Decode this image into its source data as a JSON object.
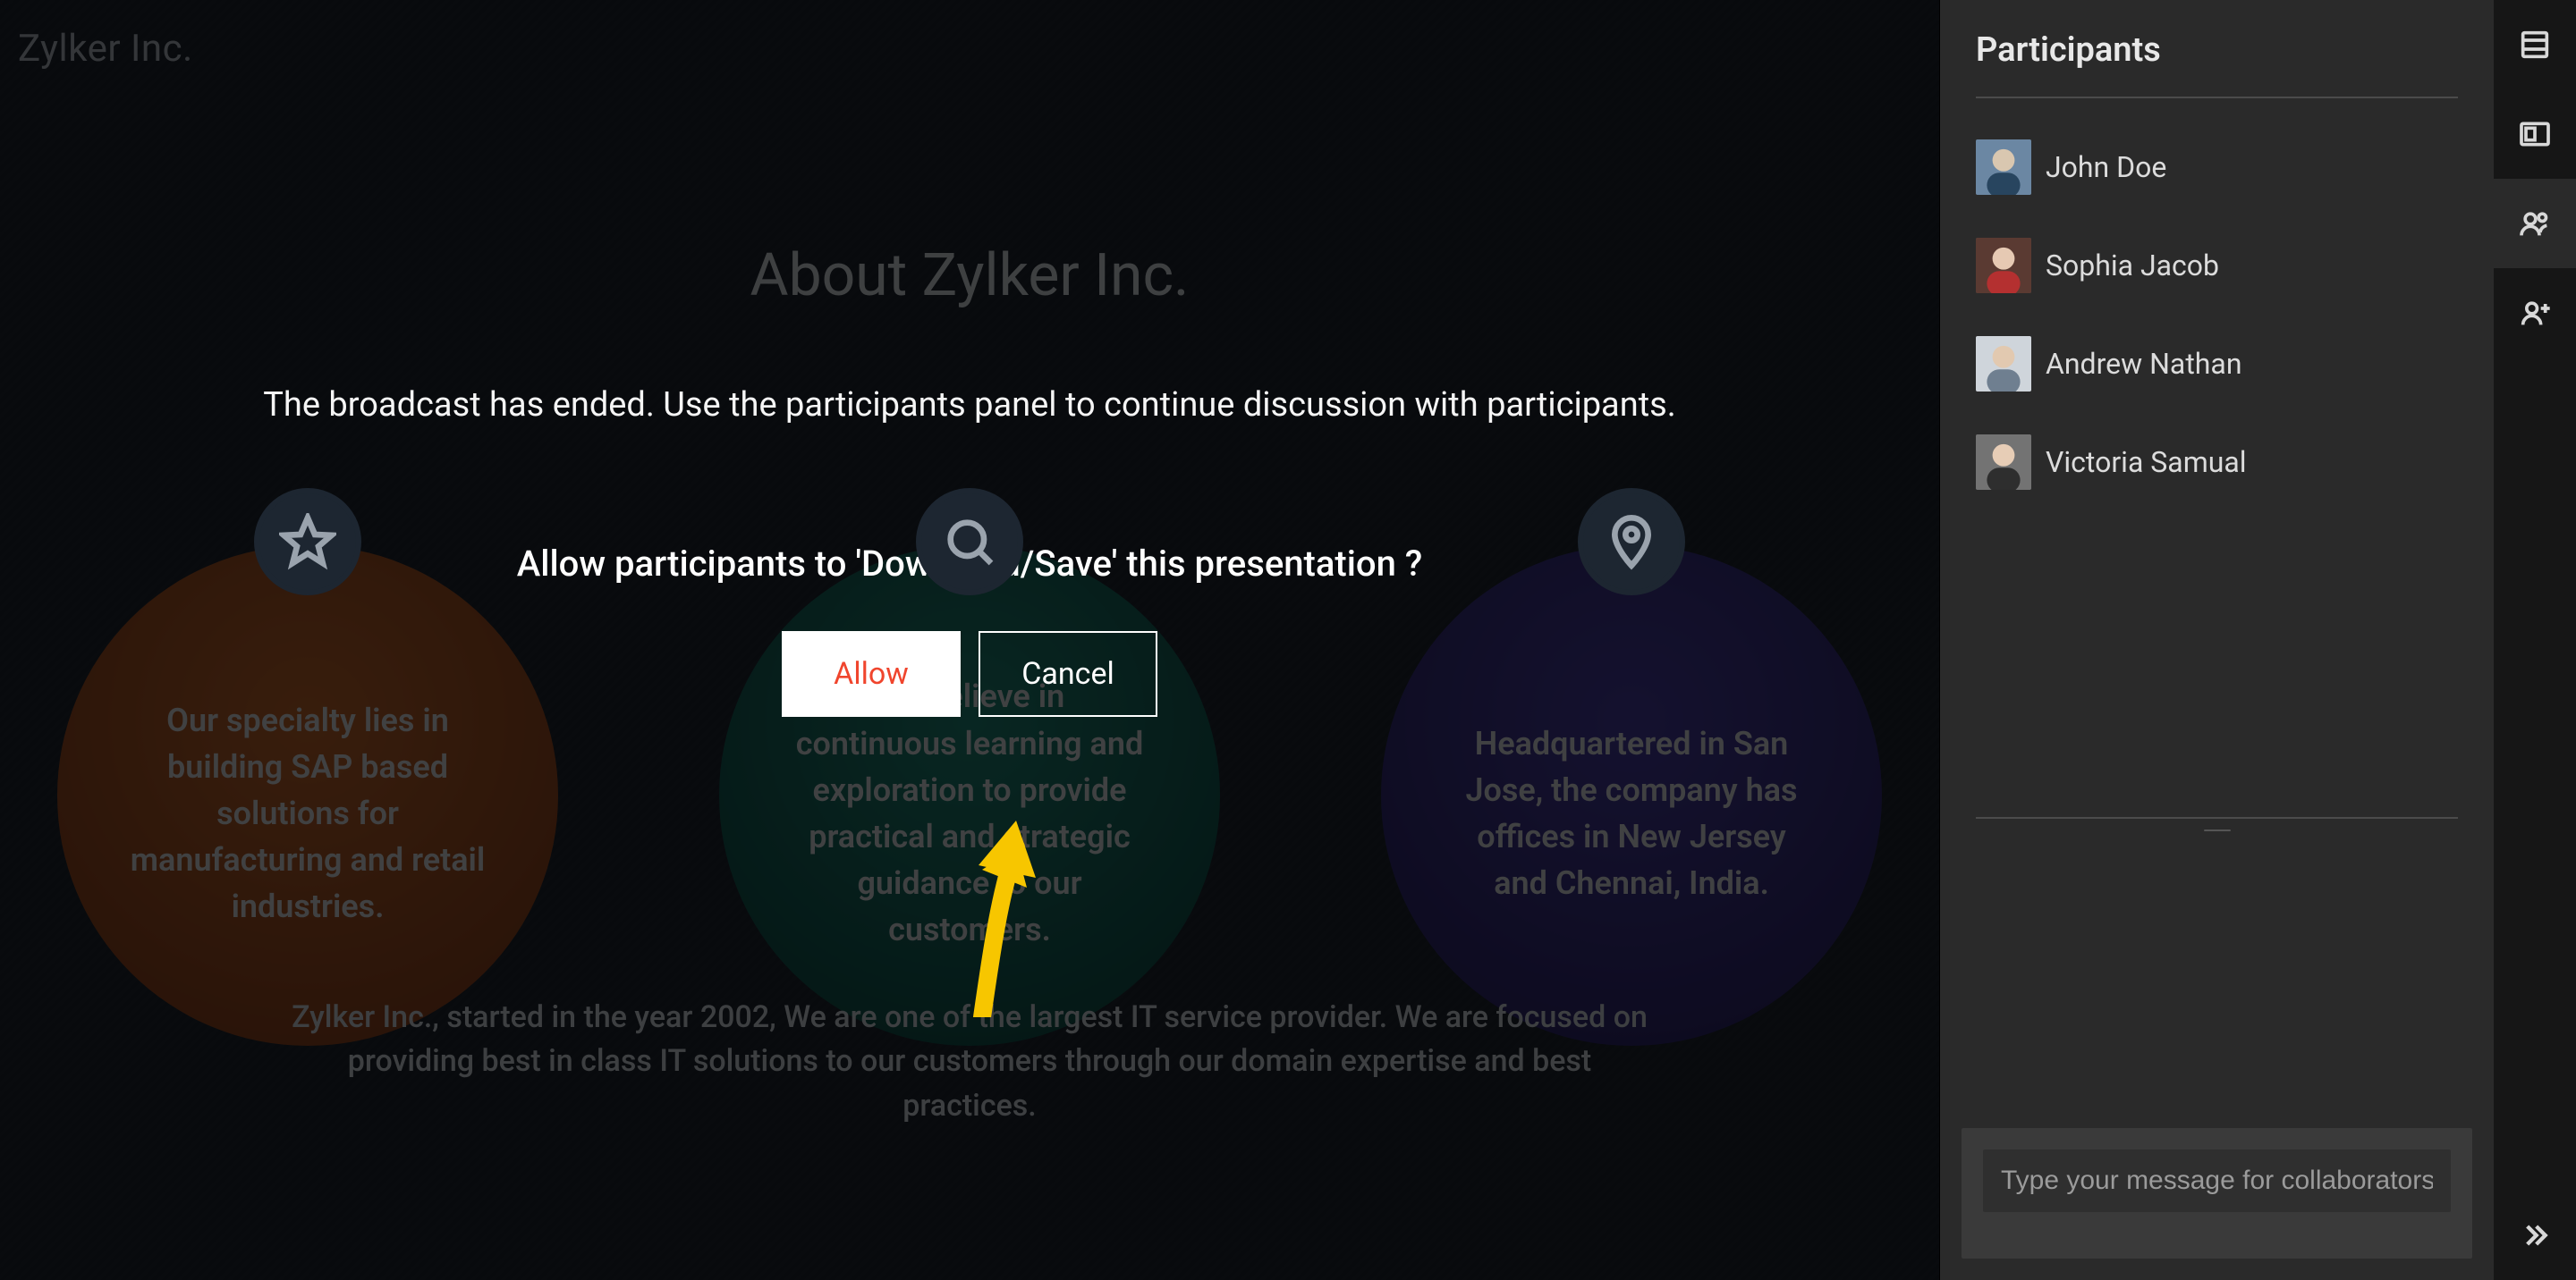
{
  "slide": {
    "company": "Zylker Inc.",
    "heading": "About Zylker Inc.",
    "circle1": "Our specialty lies in building SAP based solutions for manufacturing and retail industries.",
    "circle2": "We believe in continuous learning and exploration to provide practical and strategic guidance to our customers.",
    "circle3": "Headquartered in San Jose, the company has offices in New Jersey and Chennai, India.",
    "footer": "Zylker Inc., started in the year 2002, We are one of the largest IT service provider. We are focused on providing best in class IT solutions to our customers through our domain expertise and best practices."
  },
  "modal": {
    "broadcast_ended": "The broadcast has ended. Use the participants panel to continue discussion with participants.",
    "question": "Allow participants to 'Download/Save' this presentation ?",
    "allow_label": "Allow",
    "cancel_label": "Cancel"
  },
  "panel": {
    "title": "Participants",
    "participants": [
      {
        "name": "John Doe"
      },
      {
        "name": "Sophia Jacob"
      },
      {
        "name": "Andrew Nathan"
      },
      {
        "name": "Victoria Samual"
      }
    ],
    "chat_placeholder": "Type your message for collaborators..."
  },
  "colors": {
    "accent": "#f0452d"
  }
}
